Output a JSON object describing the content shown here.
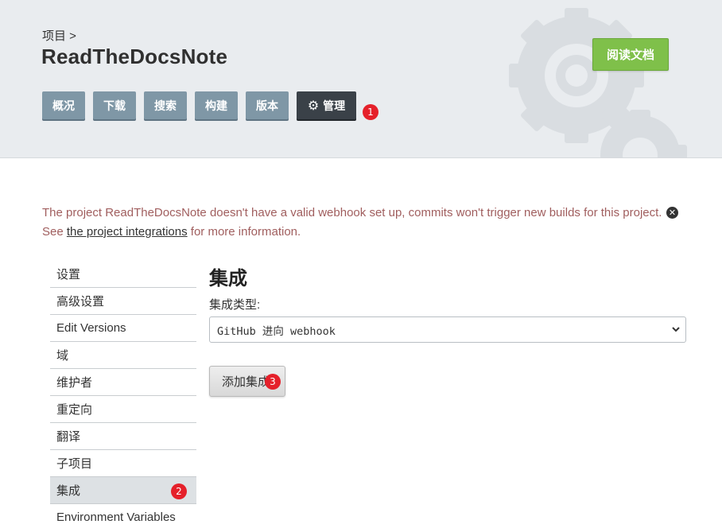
{
  "header": {
    "breadcrumb": "项目 >",
    "title": "ReadTheDocsNote",
    "read_docs_label": "阅读文档",
    "nav": [
      {
        "label": "概况"
      },
      {
        "label": "下载"
      },
      {
        "label": "搜索"
      },
      {
        "label": "构建"
      },
      {
        "label": "版本"
      },
      {
        "label": "管理",
        "icon": "gear-icon",
        "active": true
      }
    ]
  },
  "annotations": [
    "1",
    "2",
    "3"
  ],
  "alert": {
    "text_before": "The project ReadTheDocsNote doesn't have a valid webhook set up, commits won't trigger new builds for this project. See ",
    "link_text": "the project integrations",
    "text_after": " for more information.",
    "close_icon": "close-icon"
  },
  "sidebar": {
    "items": [
      {
        "label": "设置"
      },
      {
        "label": "高级设置"
      },
      {
        "label": "Edit Versions"
      },
      {
        "label": "域"
      },
      {
        "label": "维护者"
      },
      {
        "label": "重定向"
      },
      {
        "label": "翻译"
      },
      {
        "label": "子项目"
      },
      {
        "label": "集成",
        "active": true
      },
      {
        "label": "Environment Variables"
      }
    ]
  },
  "main": {
    "title": "集成",
    "field_label": "集成类型:",
    "select_value": "GitHub 进向 webhook",
    "add_button_label": "添加集成"
  },
  "colors": {
    "nav_button": "#7f97a6",
    "nav_active": "#3a4148",
    "read_docs": "#7fc04a",
    "badge": "#e5202a",
    "alert_text": "#a05e5e"
  }
}
